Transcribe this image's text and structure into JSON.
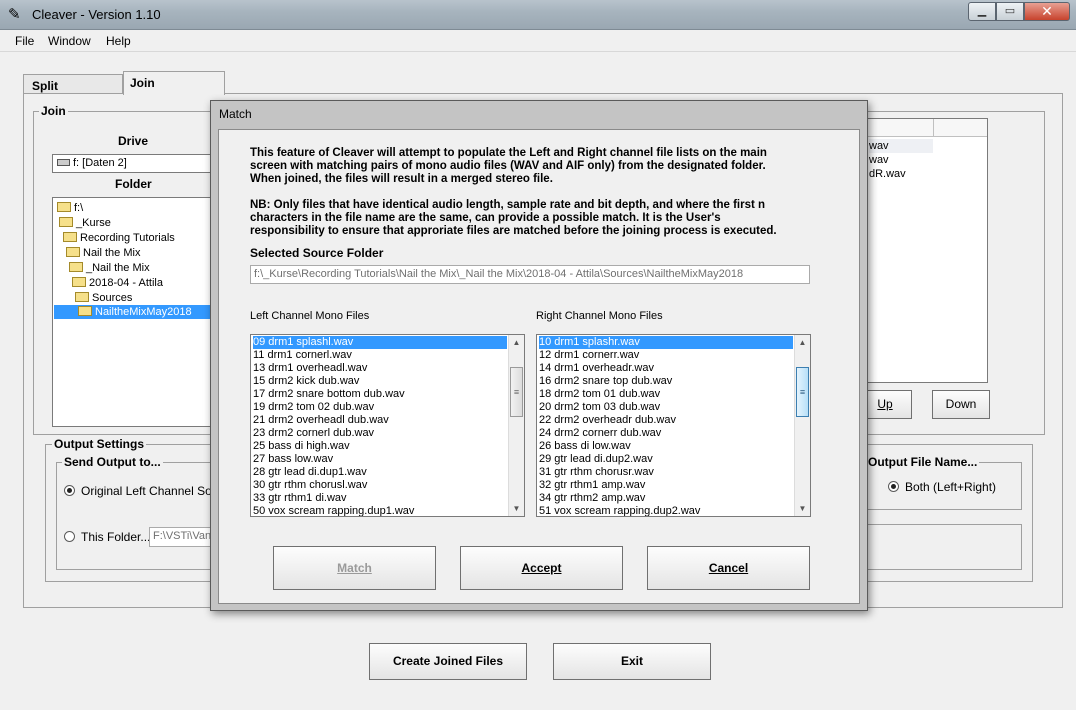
{
  "window": {
    "title": "Cleaver - Version 1.10",
    "controls": {
      "minimize": "▁",
      "maximize": "▭",
      "close": "✕"
    }
  },
  "menu": [
    "File",
    "Window",
    "Help"
  ],
  "tabs": [
    {
      "label": "Split",
      "active": false
    },
    {
      "label": "Join",
      "active": true
    }
  ],
  "join": {
    "group_label": "Join",
    "drive_label": "Drive",
    "drive_value": "f: [Daten 2]",
    "folder_label": "Folder",
    "folder_tree": [
      {
        "label": "f:\\",
        "indent": 0
      },
      {
        "label": "_Kurse",
        "indent": 1
      },
      {
        "label": "Recording Tutorials",
        "indent": 2
      },
      {
        "label": "Nail the Mix",
        "indent": 3
      },
      {
        "label": "_Nail the Mix",
        "indent": 4
      },
      {
        "label": "2018-04 - Attila",
        "indent": 5
      },
      {
        "label": "Sources",
        "indent": 6
      },
      {
        "label": "NailtheMixMay2018",
        "indent": 7,
        "selected": true
      }
    ],
    "right_list_rows": [
      "wav",
      "wav",
      "dR.wav"
    ],
    "up_button": "Up",
    "down_button": "Down"
  },
  "output_settings": {
    "group_label": "Output Settings",
    "send_output_label": "Send Output to...",
    "option_original": "Original Left Channel Source",
    "option_this_folder": "This Folder...",
    "this_folder_path": "F:\\VSTi\\Van",
    "output_file_name_label": "Output File Name...",
    "output_file_option": "Both (Left+Right)"
  },
  "bottom_buttons": {
    "create_joined": "Create Joined Files",
    "exit": "Exit"
  },
  "dialog": {
    "title": "Match",
    "intro_lines": [
      "This feature of Cleaver will attempt to populate the Left and Right channel file lists on the main",
      "screen with matching pairs of mono audio files (WAV and AIF only) from the designated folder.",
      "When joined, the files will result in a merged stereo file."
    ],
    "nb_lines": [
      "NB: Only files that have identical audio length, sample rate and bit depth, and where the first n",
      "characters in the file name are the same, can provide a possible match.  It is the User's",
      "responsibility to ensure that approriate files are matched before the joining process is executed."
    ],
    "source_folder_label": "Selected Source Folder",
    "source_folder_path": "f:\\_Kurse\\Recording Tutorials\\Nail the Mix\\_Nail the Mix\\2018-04 - Attila\\Sources\\NailtheMixMay2018",
    "left_label": "Left Channel Mono Files",
    "right_label": "Right Channel Mono Files",
    "left_files": [
      "09 drm1 splashl.wav",
      "11 drm1 cornerl.wav",
      "13 drm1 overheadl.wav",
      "15 drm2 kick dub.wav",
      "17 drm2 snare bottom dub.wav",
      "19 drm2 tom 02 dub.wav",
      "21 drm2 overheadl dub.wav",
      "23 drm2 cornerl dub.wav",
      "25 bass di high.wav",
      "27 bass low.wav",
      "28 gtr lead di.dup1.wav",
      "30 gtr rthm chorusl.wav",
      "33 gtr rthm1 di.wav",
      "50 vox scream rapping.dup1.wav"
    ],
    "right_files": [
      "10 drm1 splashr.wav",
      "12 drm1 cornerr.wav",
      "14 drm1 overheadr.wav",
      "16 drm2 snare top dub.wav",
      "18 drm2 tom 01 dub.wav",
      "20 drm2 tom 03 dub.wav",
      "22 drm2 overheadr dub.wav",
      "24 drm2 cornerr dub.wav",
      "26 bass di low.wav",
      "29 gtr lead di.dup2.wav",
      "31 gtr rthm chorusr.wav",
      "32 gtr rthm1 amp.wav",
      "34 gtr rthm2 amp.wav",
      "51 vox scream rapping.dup2.wav"
    ],
    "buttons": {
      "match": "Match",
      "accept": "Accept",
      "cancel": "Cancel"
    }
  }
}
